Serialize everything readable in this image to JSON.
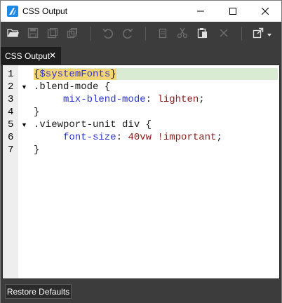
{
  "window": {
    "title": "CSS Output",
    "icons": {
      "app": "app-logo-icon",
      "minimize": "minimize-icon",
      "maximize": "maximize-icon",
      "close": "close-icon"
    }
  },
  "toolbar": {
    "buttons": [
      {
        "name": "open-folder-icon",
        "enabled": true
      },
      {
        "name": "save-icon",
        "enabled": false
      },
      {
        "name": "save-as-icon",
        "enabled": false
      },
      {
        "name": "save-all-icon",
        "enabled": false
      },
      {
        "name": "undo-icon",
        "enabled": false
      },
      {
        "name": "redo-icon",
        "enabled": false
      },
      {
        "name": "copy-icon",
        "enabled": false
      },
      {
        "name": "cut-icon",
        "enabled": false
      },
      {
        "name": "paste-icon",
        "enabled": true
      },
      {
        "name": "delete-icon",
        "enabled": false
      },
      {
        "name": "export-icon",
        "enabled": true
      },
      {
        "name": "dropdown-arrow-icon",
        "enabled": true
      }
    ]
  },
  "tabs": [
    {
      "label": "CSS Output",
      "close": "✕"
    }
  ],
  "editor": {
    "line_numbers": [
      "1",
      "2",
      "3",
      "4",
      "5",
      "6",
      "7"
    ],
    "lines": [
      {
        "parts": [
          "{",
          "$systemFonts",
          "}"
        ]
      },
      {
        "parts": [
          ".blend-mode {"
        ]
      },
      {
        "parts": [
          "mix-blend-mode",
          ": ",
          "lighten",
          ";"
        ]
      },
      {
        "parts": [
          "}"
        ]
      },
      {
        "parts": [
          ".viewport-unit div {"
        ]
      },
      {
        "parts": [
          "font-size",
          ": ",
          "40vw !important",
          ";"
        ]
      },
      {
        "parts": [
          "}"
        ]
      }
    ],
    "fold_marker": "▼"
  },
  "bottom": {
    "restore_label": "Restore Defaults"
  },
  "colors": {
    "toolbar_bg": "#3c3c3c",
    "highlight_line": "#d9ebd2",
    "variable_highlight": "#f2d675",
    "property": "#2a33cc",
    "value": "#8b1a1a"
  }
}
